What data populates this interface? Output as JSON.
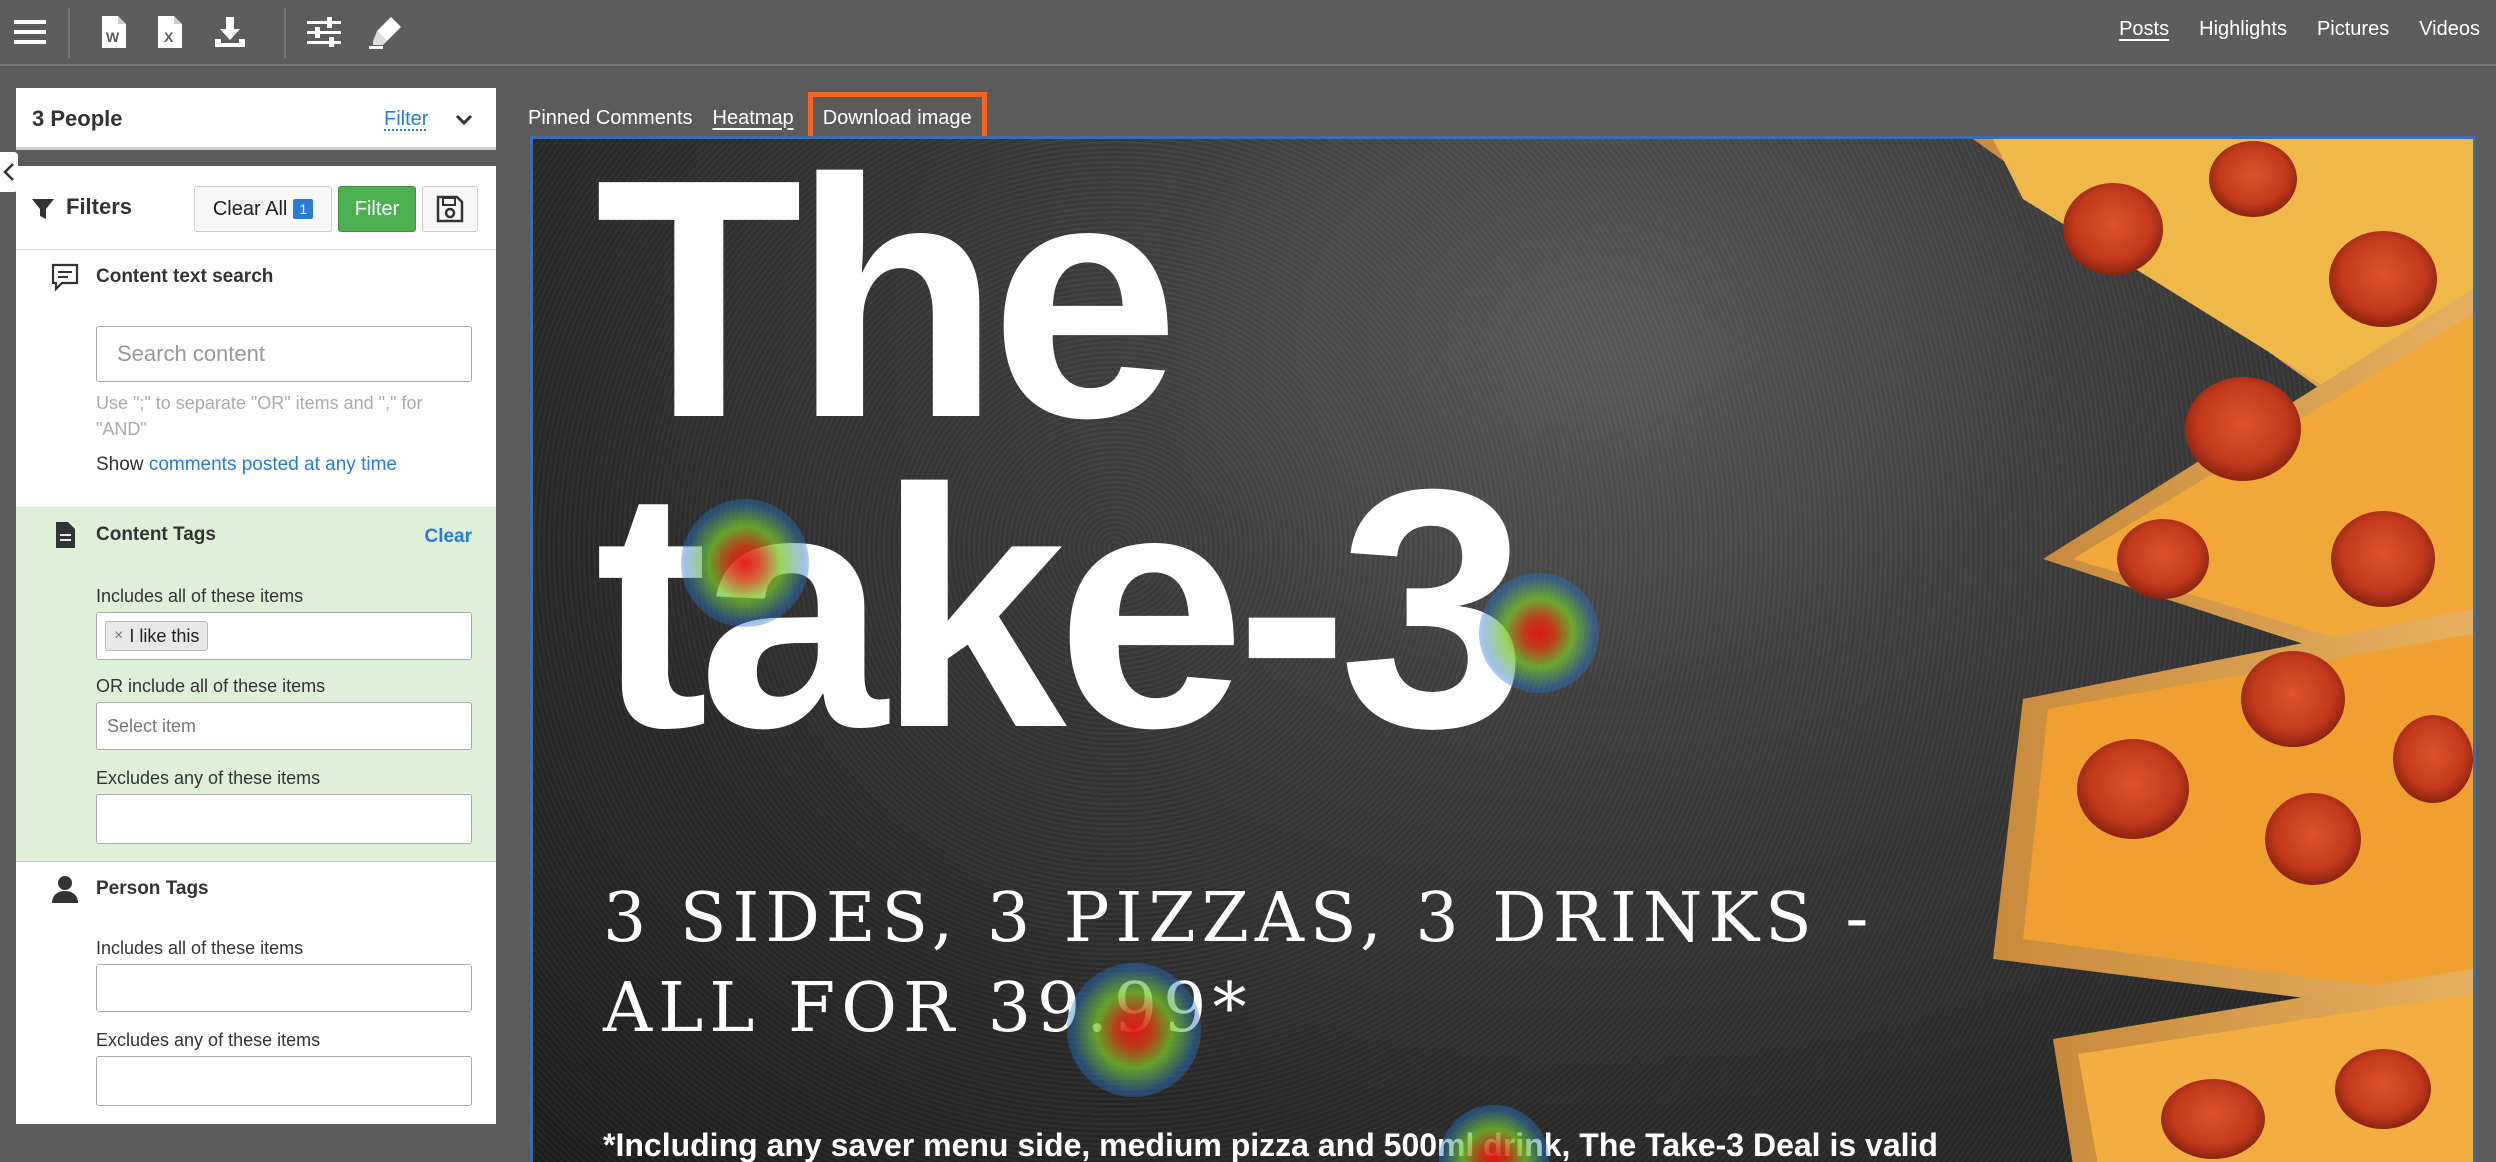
{
  "topnav": [
    "Posts",
    "Highlights",
    "Pictures",
    "Videos"
  ],
  "toolbar_icons": [
    "menu-icon",
    "word-export-icon",
    "excel-export-icon",
    "download-icon",
    "settings-sliders-icon",
    "highlighter-icon"
  ],
  "people": {
    "title": "3 People",
    "filter_link": "Filter"
  },
  "filters": {
    "title": "Filters",
    "clear_all": "Clear All",
    "clear_count": "1",
    "filter_button": "Filter"
  },
  "content_search": {
    "title": "Content text search",
    "placeholder": "Search content",
    "hint": "Use \";\" to separate \"OR\" items and \",\" for \"AND\"",
    "show_prefix": "Show",
    "show_link": "comments posted at any time"
  },
  "content_tags": {
    "title": "Content Tags",
    "clear": "Clear",
    "includes_label": "Includes all of these items",
    "includes_tag": "I like this",
    "or_label": "OR include all of these items",
    "or_placeholder": "Select item",
    "excludes_label": "Excludes any of these items"
  },
  "person_tags": {
    "title": "Person Tags",
    "includes_label": "Includes all of these items",
    "excludes_label": "Excludes any of these items"
  },
  "tabs": [
    "Pinned Comments",
    "Heatmap",
    "Download image"
  ],
  "image": {
    "headline1": "The",
    "headline2": "take-3",
    "line1": "3 SIDES, 3 PIZZAS, 3 DRINKS -",
    "line2": "ALL FOR 39.99*",
    "fine_print": "*Including any saver menu side, medium pizza and 500ml drink, The Take-3 Deal is valid"
  },
  "colors": {
    "highlight": "#f26522",
    "accent": "#2a7bd6",
    "filter_button": "#4caf50",
    "tags_bg": "#dff0d8"
  }
}
